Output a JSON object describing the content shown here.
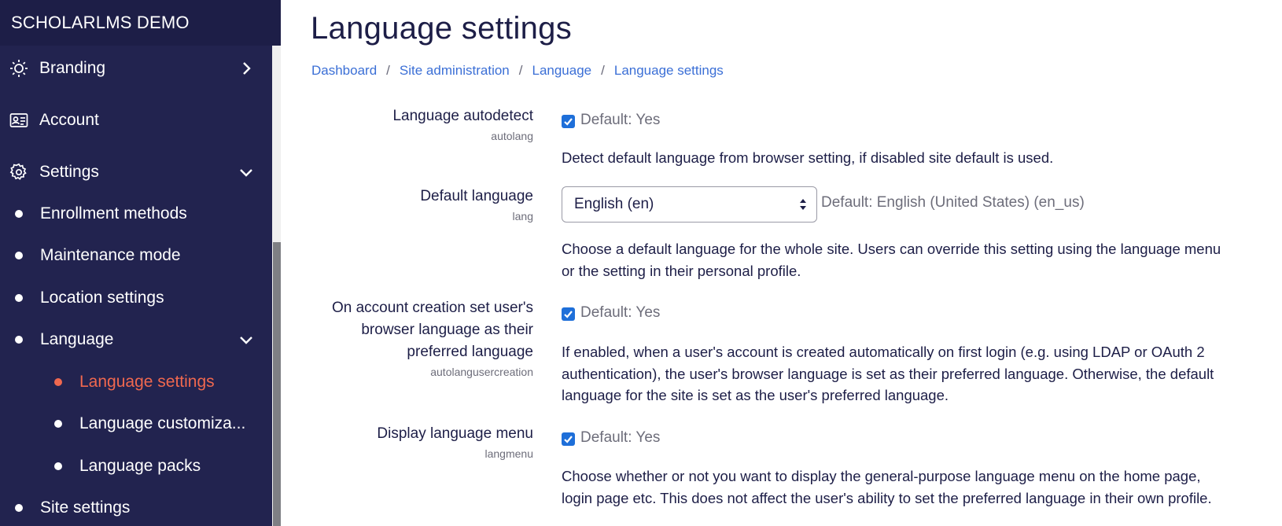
{
  "sidebar": {
    "site_name": "SCHOLARLMS DEMO",
    "items": [
      {
        "label": "Branding",
        "icon": "sun-icon",
        "chevron": "chevron-right-icon"
      },
      {
        "label": "Account",
        "icon": "id-card-icon"
      },
      {
        "label": "Settings",
        "icon": "gear-icon",
        "chevron": "chevron-down-icon"
      }
    ],
    "settings_children": [
      {
        "label": "Enrollment methods"
      },
      {
        "label": "Maintenance mode"
      },
      {
        "label": "Location settings"
      },
      {
        "label": "Language",
        "chevron": "chevron-down-icon"
      }
    ],
    "language_children": [
      {
        "label": "Language settings",
        "active": true
      },
      {
        "label": "Language customiza..."
      },
      {
        "label": "Language packs"
      }
    ],
    "after": [
      {
        "label": "Site settings"
      }
    ],
    "colors": {
      "background": "#22234f",
      "active": "#f0684f"
    }
  },
  "main": {
    "title": "Language settings",
    "breadcrumb": [
      "Dashboard",
      "Site administration",
      "Language",
      "Language settings"
    ],
    "settings": [
      {
        "title": "Language autodetect",
        "key": "autolang",
        "checked": true,
        "default": "Default: Yes",
        "description": "Detect default language from browser setting, if disabled site default is used."
      },
      {
        "title": "Default language",
        "key": "lang",
        "select_value": "English (en)",
        "default": "Default: English (United States) (en_us)",
        "description_line1": "Choose a default language for the whole site. Users can override this setting using the language menu",
        "description_line2": "or the setting in their personal profile."
      },
      {
        "title_line1": "On account creation set user's",
        "title_line2": "browser language as their",
        "title_line3": "preferred language",
        "key": "autolangusercreation",
        "checked": true,
        "default": "Default: Yes",
        "description_line1": "If enabled, when a user's account is created automatically on first login (e.g. using LDAP or OAuth 2",
        "description_line2": "authentication), the user's browser language is set as their preferred language. Otherwise, the default",
        "description_line3": "language for the site is set as the user's preferred language."
      },
      {
        "title": "Display language menu",
        "key": "langmenu",
        "checked": true,
        "default": "Default: Yes",
        "description_line1": "Choose whether or not you want to display the general-purpose language menu on the home page,",
        "description_line2": "login page etc. This does not affect the user's ability to set the preferred language in their own profile."
      }
    ],
    "colors": {
      "link": "#3b6fd6",
      "text": "#1d1e47",
      "checkbox": "#1e6fd9"
    }
  }
}
